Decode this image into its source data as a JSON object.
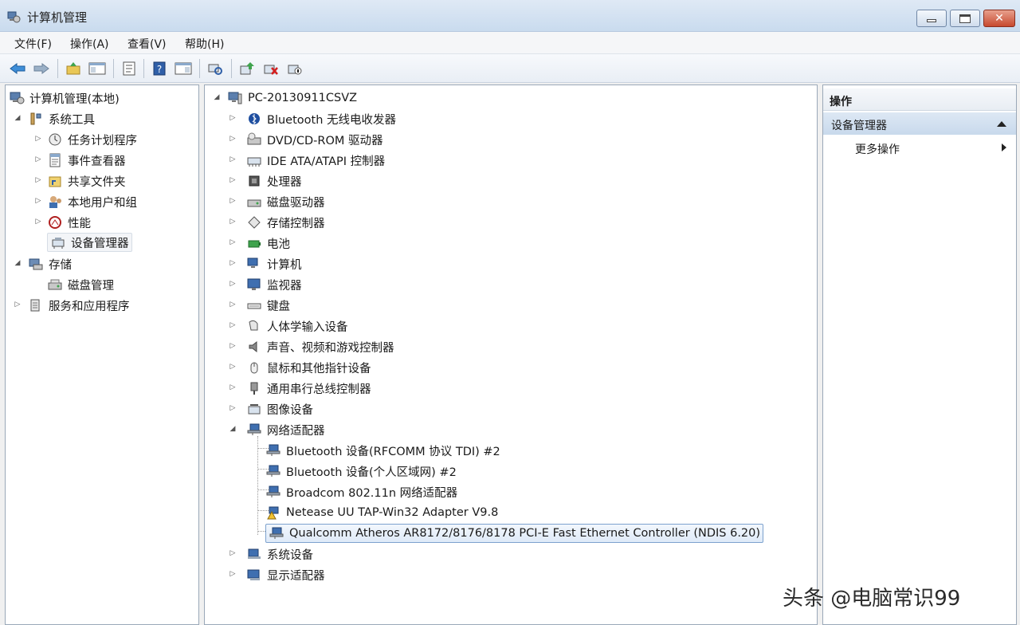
{
  "window": {
    "title": "计算机管理"
  },
  "menu": [
    "文件(F)",
    "操作(A)",
    "查看(V)",
    "帮助(H)"
  ],
  "left_tree": [
    {
      "label": "计算机管理(本地)",
      "expander": "",
      "icon": "computer-management-icon"
    },
    {
      "label": "系统工具",
      "expander": "◢",
      "icon": "system-tools-icon"
    },
    {
      "label": "任务计划程序",
      "expander": "▷",
      "icon": "task-scheduler-icon"
    },
    {
      "label": "事件查看器",
      "expander": "▷",
      "icon": "event-viewer-icon"
    },
    {
      "label": "共享文件夹",
      "expander": "▷",
      "icon": "shared-folder-icon"
    },
    {
      "label": "本地用户和组",
      "expander": "▷",
      "icon": "local-users-icon"
    },
    {
      "label": "性能",
      "expander": "▷",
      "icon": "performance-icon"
    },
    {
      "label": "设备管理器",
      "expander": "",
      "icon": "device-manager-icon"
    },
    {
      "label": "存储",
      "expander": "◢",
      "icon": "storage-icon"
    },
    {
      "label": "磁盘管理",
      "expander": "",
      "icon": "disk-management-icon"
    },
    {
      "label": "服务和应用程序",
      "expander": "▷",
      "icon": "services-icon"
    }
  ],
  "device_tree": {
    "root": "PC-20130911CSVZ",
    "categories": [
      "Bluetooth 无线电收发器",
      "DVD/CD-ROM 驱动器",
      "IDE ATA/ATAPI 控制器",
      "处理器",
      "磁盘驱动器",
      "存储控制器",
      "电池",
      "计算机",
      "监视器",
      "键盘",
      "人体学输入设备",
      "声音、视频和游戏控制器",
      "鼠标和其他指针设备",
      "通用串行总线控制器",
      "图像设备",
      "网络适配器"
    ],
    "network_adapters": [
      "Bluetooth 设备(RFCOMM 协议 TDI) #2",
      "Bluetooth 设备(个人区域网) #2",
      "Broadcom 802.11n 网络适配器",
      "Netease UU TAP-Win32 Adapter V9.8",
      "Qualcomm Atheros AR8172/8176/8178 PCI-E Fast Ethernet Controller (NDIS 6.20)"
    ],
    "after": [
      "系统设备",
      "显示适配器"
    ]
  },
  "actions": {
    "header": "操作",
    "section": "设备管理器",
    "more": "更多操作"
  },
  "watermark": "头条 @电脑常识99",
  "colors": {
    "selection_border": "#7da2ce",
    "close_button": "#c74a2f"
  }
}
